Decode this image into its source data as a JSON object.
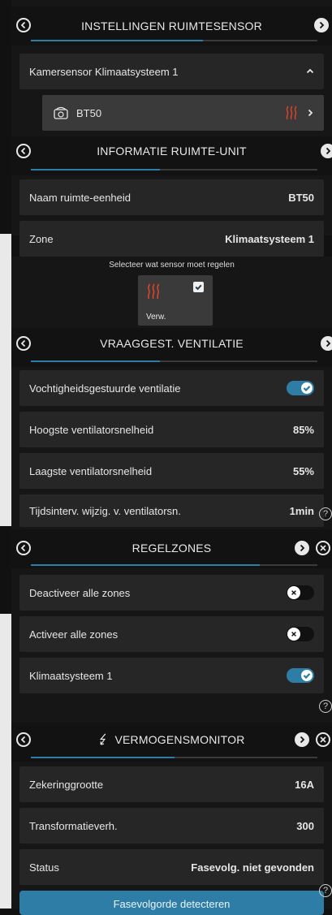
{
  "colors": {
    "accent": "#2e7da6",
    "heat": "#e0432e"
  },
  "ruimtesensor": {
    "title": "INSTELLINGEN RUIMTESENSOR",
    "group_label": "Kamersensor Klimaatsysteem 1",
    "device_name": "BT50",
    "progress": 0.6
  },
  "ruimte_unit": {
    "title": "INFORMATIE RUIMTE-UNIT",
    "progress": 0.45,
    "rows": [
      {
        "label": "Naam ruimte-eenheid",
        "value": "BT50"
      },
      {
        "label": "Zone",
        "value": "Klimaatsysteem 1"
      }
    ],
    "sensor_prompt": "Selecteer wat sensor moet regelen",
    "sensor_option_label": "Verw."
  },
  "ventilatie": {
    "title": "VRAAGGEST. VENTILATIE",
    "progress": 0.45,
    "rows": [
      {
        "label": "Vochtigheidsgestuurde ventilatie",
        "toggle": true
      },
      {
        "label": "Hoogste ventilatorsnelheid",
        "value": "85%"
      },
      {
        "label": "Laagste ventilatorsnelheid",
        "value": "55%"
      },
      {
        "label": "Tijdsinterv. wijzig. v. ventilatorsn.",
        "value": "1min"
      }
    ]
  },
  "regelzones": {
    "title": "REGELZONES",
    "progress": 0.8,
    "rows": [
      {
        "label": "Deactiveer alle zones",
        "toggle": false
      },
      {
        "label": "Activeer alle zones",
        "toggle": false
      },
      {
        "label": "Klimaatsysteem 1",
        "toggle": true
      }
    ]
  },
  "vermogensmonitor": {
    "title": "VERMOGENSMONITOR",
    "progress": 0.5,
    "rows": [
      {
        "label": "Zekeringgrootte",
        "value": "16A"
      },
      {
        "label": "Transformatieverh.",
        "value": "300"
      },
      {
        "label": "Status",
        "value": "Fasevolg. niet gevonden"
      }
    ],
    "action_button": "Fasevolgorde detecteren"
  }
}
